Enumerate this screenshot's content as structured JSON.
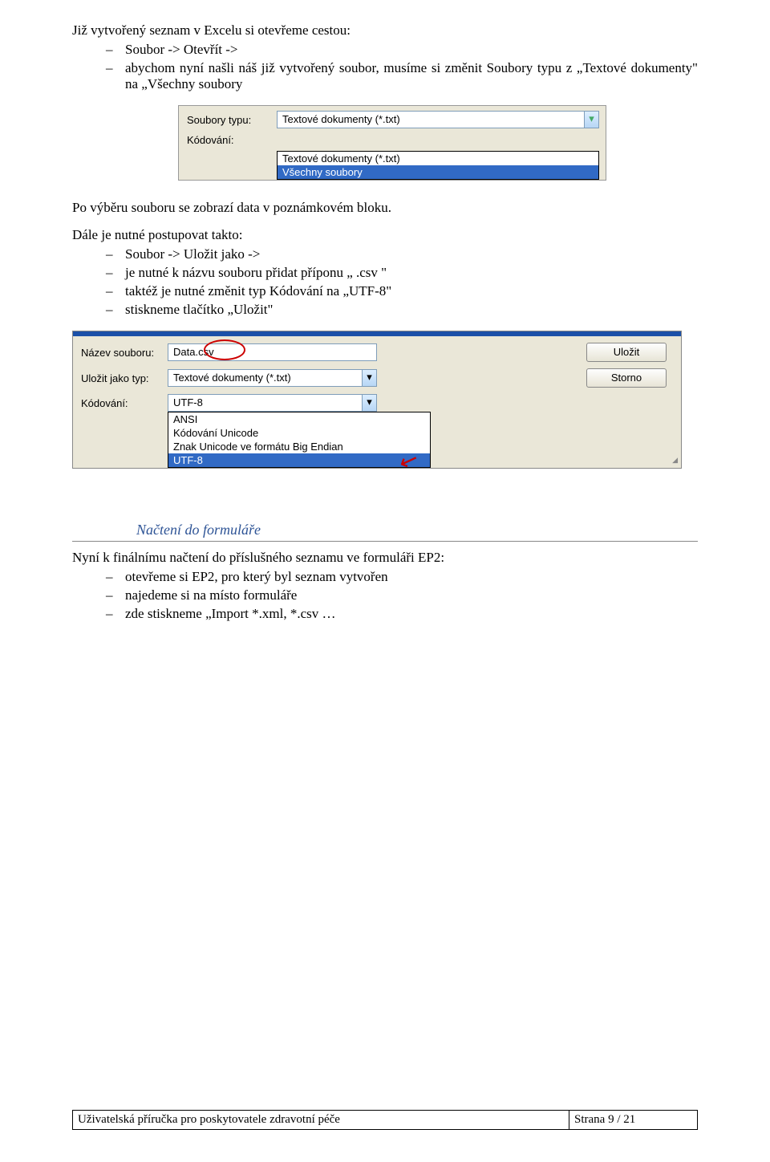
{
  "para1": "Již vytvořený seznam v Excelu si otevřeme cestou:",
  "list1": [
    "Soubor -> Otevřít ->",
    "abychom nyní našli náš již vytvořený soubor, musíme si změnit Soubory typu z „Textové dokumenty\" na „Všechny soubory"
  ],
  "shot1": {
    "label_type": "Soubory typu:",
    "label_encoding": "Kódování:",
    "combo_value": "Textové dokumenty (*.txt)",
    "dropdown_opt1": "Textové dokumenty (*.txt)",
    "dropdown_opt2": "Všechny soubory"
  },
  "para2": "Po výběru souboru se zobrazí data v poznámkovém bloku.",
  "para3": "Dále je nutné postupovat takto:",
  "list2": [
    "Soubor -> Uložit jako ->",
    "je nutné k názvu souboru přidat příponu „ .csv \"",
    "taktéž je nutné změnit typ Kódování na „UTF-8\"",
    "stiskneme tlačítko „Uložit\""
  ],
  "shot2": {
    "label_name": "Název souboru:",
    "label_saveas": "Uložit jako typ:",
    "label_encoding": "Kódování:",
    "filename": "Data.csv",
    "filetype": "Textové dokumenty (*.txt)",
    "encoding": "UTF-8",
    "btn_save": "Uložit",
    "btn_cancel": "Storno",
    "dd_opts": [
      "ANSI",
      "Kódování Unicode",
      "Znak Unicode ve formátu Big Endian",
      "UTF-8"
    ]
  },
  "heading": "Načtení do formuláře",
  "para4": "Nyní k finálnímu načtení do příslušného seznamu ve formuláři EP2:",
  "list3": [
    "otevřeme si EP2, pro který byl seznam vytvořen",
    "najedeme si na místo formuláře",
    "zde stiskneme „Import *.xml, *.csv …"
  ],
  "footer": {
    "left": "Uživatelská příručka pro poskytovatele zdravotní péče",
    "right": "Strana 9 / 21"
  }
}
